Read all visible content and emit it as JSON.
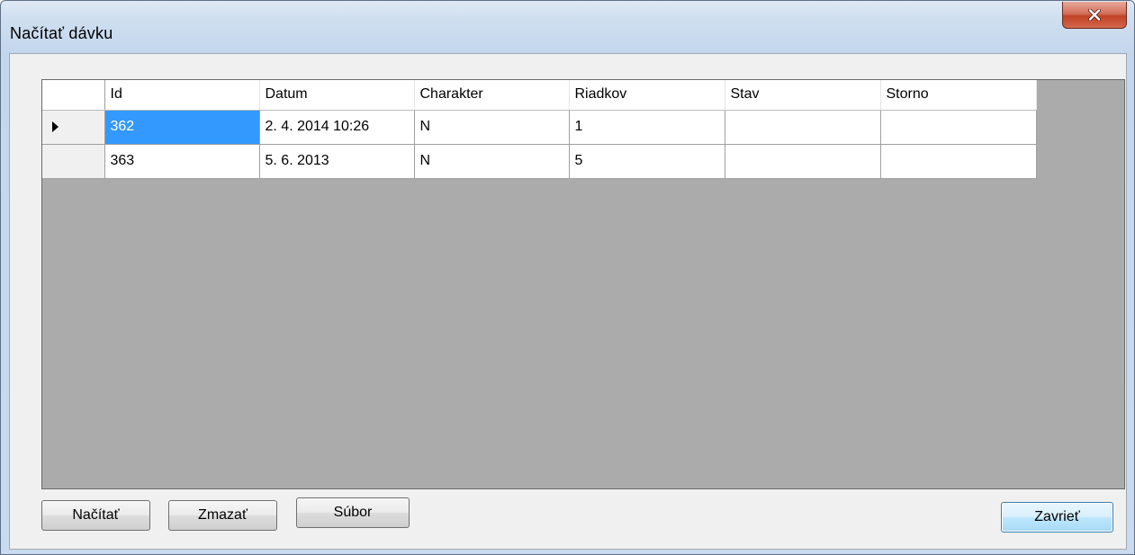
{
  "window": {
    "title": "Načítať dávku"
  },
  "grid": {
    "columns": [
      "Id",
      "Datum",
      "Charakter",
      "Riadkov",
      "Stav",
      "Storno"
    ],
    "rows": [
      {
        "cells": [
          "362",
          "2. 4. 2014 10:26",
          "N",
          "1",
          "",
          ""
        ],
        "current": true
      },
      {
        "cells": [
          "363",
          "5. 6. 2013",
          "N",
          "5",
          "",
          ""
        ],
        "current": false
      }
    ]
  },
  "buttons": {
    "load": "Načítať",
    "delete": "Zmazať",
    "file": "Súbor",
    "close": "Zavrieť"
  },
  "colors": {
    "selection": "#3399ff",
    "grid_background": "#ababab",
    "close_button": "#c14226"
  },
  "icons": {
    "current_row": "row-pointer-icon",
    "close": "close-icon"
  }
}
